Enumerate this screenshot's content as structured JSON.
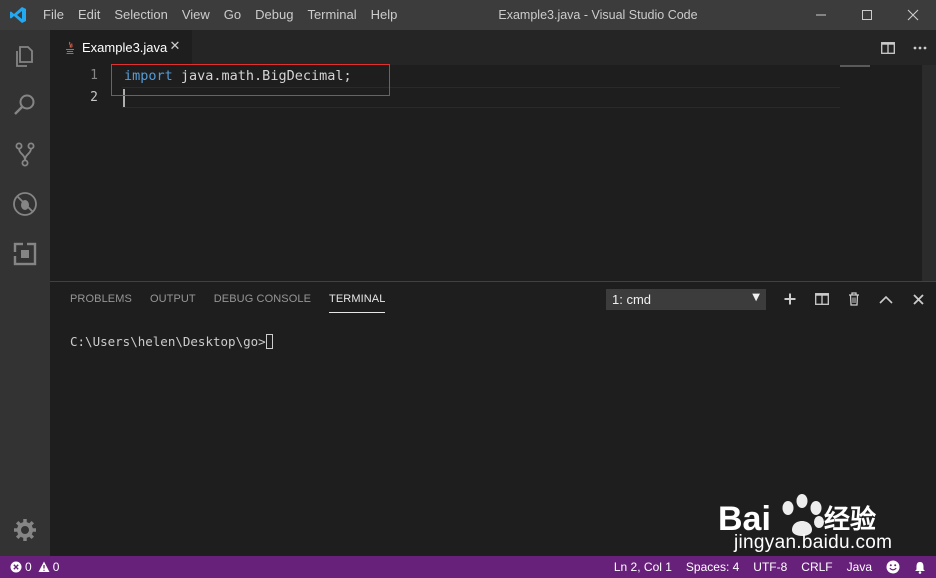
{
  "titlebar": {
    "title": "Example3.java - Visual Studio Code",
    "menu": [
      "File",
      "Edit",
      "Selection",
      "View",
      "Go",
      "Debug",
      "Terminal",
      "Help"
    ]
  },
  "activitybar": {
    "items": [
      "explorer-icon",
      "search-icon",
      "source-control-icon",
      "debug-icon",
      "extensions-icon"
    ],
    "bottom": "settings-gear-icon"
  },
  "editor": {
    "tab": {
      "label": "Example3.java",
      "icon": "java-icon"
    },
    "lines": [
      {
        "number": "1",
        "keyword": "import",
        "rest": " java.math.BigDecimal;"
      },
      {
        "number": "2",
        "keyword": "",
        "rest": ""
      }
    ]
  },
  "panel": {
    "tabs": [
      "PROBLEMS",
      "OUTPUT",
      "DEBUG CONSOLE",
      "TERMINAL"
    ],
    "active_tab": "TERMINAL",
    "terminal_select": "1: cmd",
    "terminal_prompt": "C:\\Users\\helen\\Desktop\\go>"
  },
  "statusbar": {
    "errors": "0",
    "warnings": "0",
    "position": "Ln 2, Col 1",
    "spaces": "Spaces: 4",
    "encoding": "UTF-8",
    "eol": "CRLF",
    "language": "Java"
  },
  "watermark": {
    "brand": "Bai",
    "brand_cn": "经验",
    "url": "jingyan.baidu.com"
  },
  "colors": {
    "statusbar": "#68217a",
    "keyword": "#569cd6",
    "highlight": "#e0302f",
    "vscode_blue": "#23a9f2"
  }
}
